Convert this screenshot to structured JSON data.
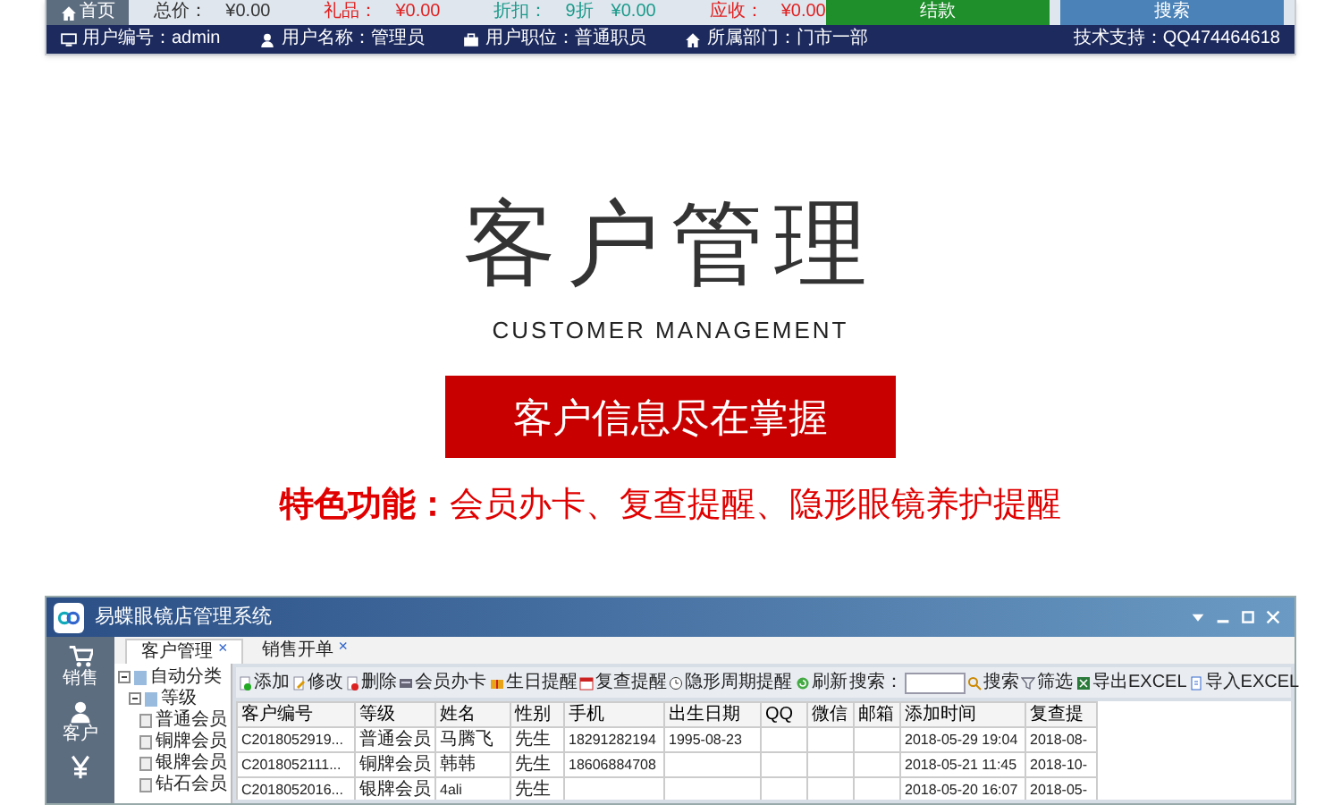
{
  "top_screenshot": {
    "nav_tab": "首页",
    "totals": [
      {
        "label": "总价：",
        "values": [
          "¥0.00"
        ],
        "color": "#333333"
      },
      {
        "label": "礼品：",
        "values": [
          "¥0.00"
        ],
        "color": "#e02020"
      },
      {
        "label": "折扣：",
        "values": [
          "9折",
          "¥0.00"
        ],
        "color": "#1a9a8a"
      },
      {
        "label": "应收：",
        "values": [
          "¥0.00"
        ],
        "color": "#e02020"
      }
    ],
    "buttons": [
      {
        "label": "结款",
        "kind": "confirm"
      },
      {
        "label": "搜索",
        "kind": "search"
      }
    ],
    "status_bar": [
      {
        "text": "用户编号：admin"
      },
      {
        "text": "用户名称：管理员"
      },
      {
        "text": "用户职位：普通职员"
      },
      {
        "text": "所属部门：门市一部"
      }
    ],
    "support": "技术支持：QQ474464618"
  },
  "title": "客户管理",
  "subtitle": "CUSTOMER MANAGEMENT",
  "banner": "客户信息尽在掌握",
  "features": "**特色功能：**会员办卡、复查提醒、隐形眼镜养护提醒",
  "app": {
    "title": "易蝶眼镜店管理系统",
    "tabs": [
      {
        "label": "客户管理",
        "close": "×",
        "selected": true
      },
      {
        "label": "销售开单",
        "close": "×",
        "selected": false
      }
    ],
    "sidebar": [
      {
        "label": "销售"
      },
      {
        "label": "客户"
      }
    ],
    "tree": {
      "label": "自动分类",
      "expanded": true,
      "children": [
        {
          "label": "等级",
          "expanded": true,
          "children": [
            {
              "label": "普通会员"
            },
            {
              "label": "铜牌会员"
            },
            {
              "label": "银牌会员"
            },
            {
              "label": "钻石会员"
            }
          ]
        }
      ]
    },
    "toolbar": [
      {
        "kind": "button",
        "label": "添加"
      },
      {
        "kind": "button",
        "label": "修改"
      },
      {
        "kind": "button",
        "label": "删除"
      },
      {
        "kind": "button",
        "label": "会员办卡"
      },
      {
        "kind": "separator"
      },
      {
        "kind": "button",
        "label": "生日提醒"
      },
      {
        "kind": "button",
        "label": "复查提醒"
      },
      {
        "kind": "button",
        "label": "隐形周期提醒"
      },
      {
        "kind": "separator"
      },
      {
        "kind": "button",
        "label": "刷新"
      },
      {
        "kind": "label",
        "label": "搜索："
      },
      {
        "kind": "input"
      },
      {
        "kind": "button",
        "label": "搜索"
      },
      {
        "kind": "button",
        "label": "筛选"
      },
      {
        "kind": "separator"
      },
      {
        "kind": "button",
        "label": "导出EXCEL"
      },
      {
        "kind": "button",
        "label": "导入EXCEL"
      }
    ],
    "table": {
      "columns": [
        "客户编号",
        "等级",
        "姓名",
        "性别",
        "手机",
        "出生日期",
        "QQ",
        "微信",
        "邮箱",
        "添加时间",
        "复查提"
      ],
      "rows": [
        [
          "C2018052919...",
          "普通会员",
          "马腾飞",
          "先生",
          "18291282194",
          "1995-08-23",
          "",
          "",
          "",
          "2018-05-29 19:04",
          "2018-08-"
        ],
        [
          "C2018052111...",
          "铜牌会员",
          "韩韩",
          "先生",
          "18606884708",
          "",
          "",
          "",
          "",
          "2018-05-21 11:45",
          "2018-10-"
        ],
        [
          "C2018052016...",
          "银牌会员",
          "4ali",
          "先生",
          "",
          "",
          "",
          "",
          "",
          "2018-05-20 16:07",
          "2018-05-"
        ]
      ]
    }
  }
}
